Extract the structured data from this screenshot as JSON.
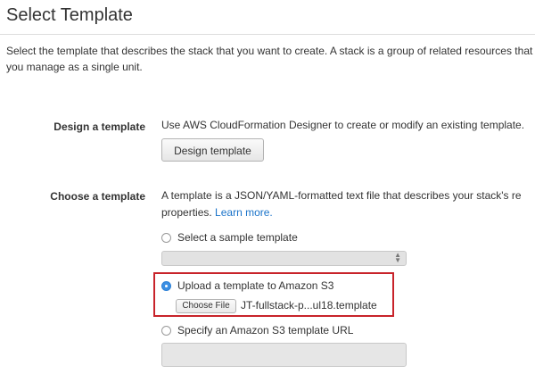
{
  "page": {
    "title": "Select Template",
    "intro": "Select the template that describes the stack that you want to create. A stack is a group of related resources that you manage as a single unit."
  },
  "design": {
    "label": "Design a template",
    "description": "Use AWS CloudFormation Designer to create or modify an existing template.",
    "button_label": "Design template"
  },
  "choose": {
    "label": "Choose a template",
    "description_line1": "A template is a JSON/YAML-formatted text file that describes your stack's re",
    "description_line2": "properties.",
    "learn_more": "Learn more.",
    "options": {
      "sample": {
        "label": "Select a sample template",
        "checked": false
      },
      "upload": {
        "label": "Upload a template to Amazon S3",
        "checked": true
      },
      "url": {
        "label": "Specify an Amazon S3 template URL",
        "checked": false
      }
    },
    "sample_select_value": "",
    "file_button_label": "Choose File",
    "file_name": "JT-fullstack-p...ul18.template",
    "url_value": ""
  },
  "colors": {
    "highlight_border": "#c8232a",
    "link": "#1a73c9",
    "radio_checked": "#3b8fe3"
  }
}
